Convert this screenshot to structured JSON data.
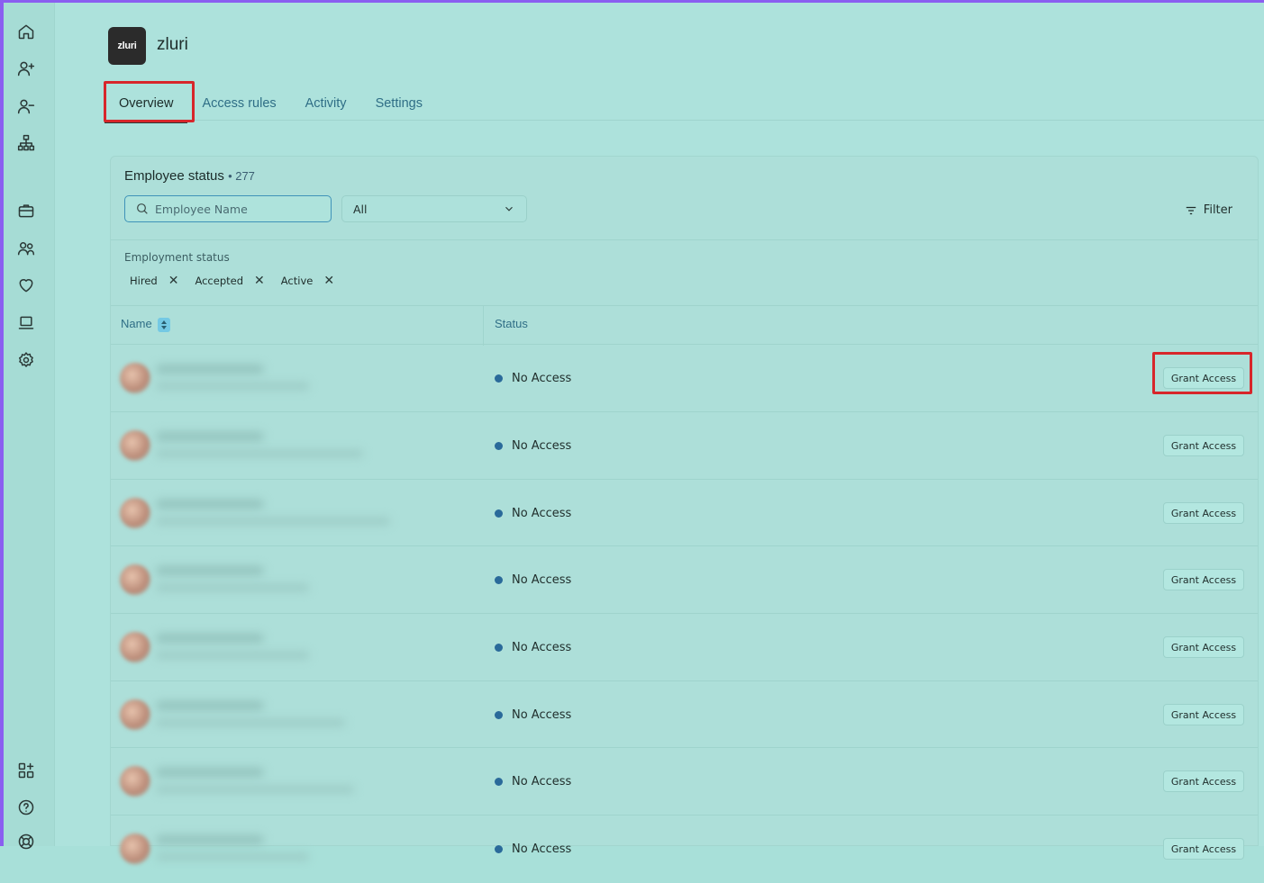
{
  "app": {
    "logo_text": "zluri",
    "name": "zluri"
  },
  "sidebar": {
    "top_icons": [
      "home-icon",
      "user-plus-icon",
      "user-minus-icon",
      "org-chart-icon"
    ],
    "mid_icons": [
      "briefcase-icon",
      "users-icon",
      "heart-icon",
      "laptop-icon",
      "settings-icon"
    ],
    "bottom_icons": [
      "apps-add-icon",
      "help-icon",
      "support-icon"
    ]
  },
  "tabs": [
    {
      "label": "Overview",
      "active": true
    },
    {
      "label": "Access rules",
      "active": false
    },
    {
      "label": "Activity",
      "active": false
    },
    {
      "label": "Settings",
      "active": false
    }
  ],
  "card": {
    "title": "Employee status",
    "count": "• 277",
    "search_placeholder": "Employee Name",
    "dropdown_value": "All",
    "filter_label": "Filter",
    "employment_status_label": "Employment status",
    "chips": [
      "Hired",
      "Accepted",
      "Active"
    ]
  },
  "table": {
    "columns": {
      "name": "Name",
      "status": "Status"
    },
    "rows": [
      {
        "status": "No Access",
        "action": "Grant Access"
      },
      {
        "status": "No Access",
        "action": "Grant Access"
      },
      {
        "status": "No Access",
        "action": "Grant Access"
      },
      {
        "status": "No Access",
        "action": "Grant Access"
      },
      {
        "status": "No Access",
        "action": "Grant Access"
      },
      {
        "status": "No Access",
        "action": "Grant Access"
      },
      {
        "status": "No Access",
        "action": "Grant Access"
      },
      {
        "status": "No Access",
        "action": "Grant Access"
      }
    ]
  },
  "colors": {
    "accent_frame": "#8a5ef0",
    "highlight": "#d7262b",
    "status_dot": "#2a6a9a",
    "background": "#ade2dc"
  }
}
